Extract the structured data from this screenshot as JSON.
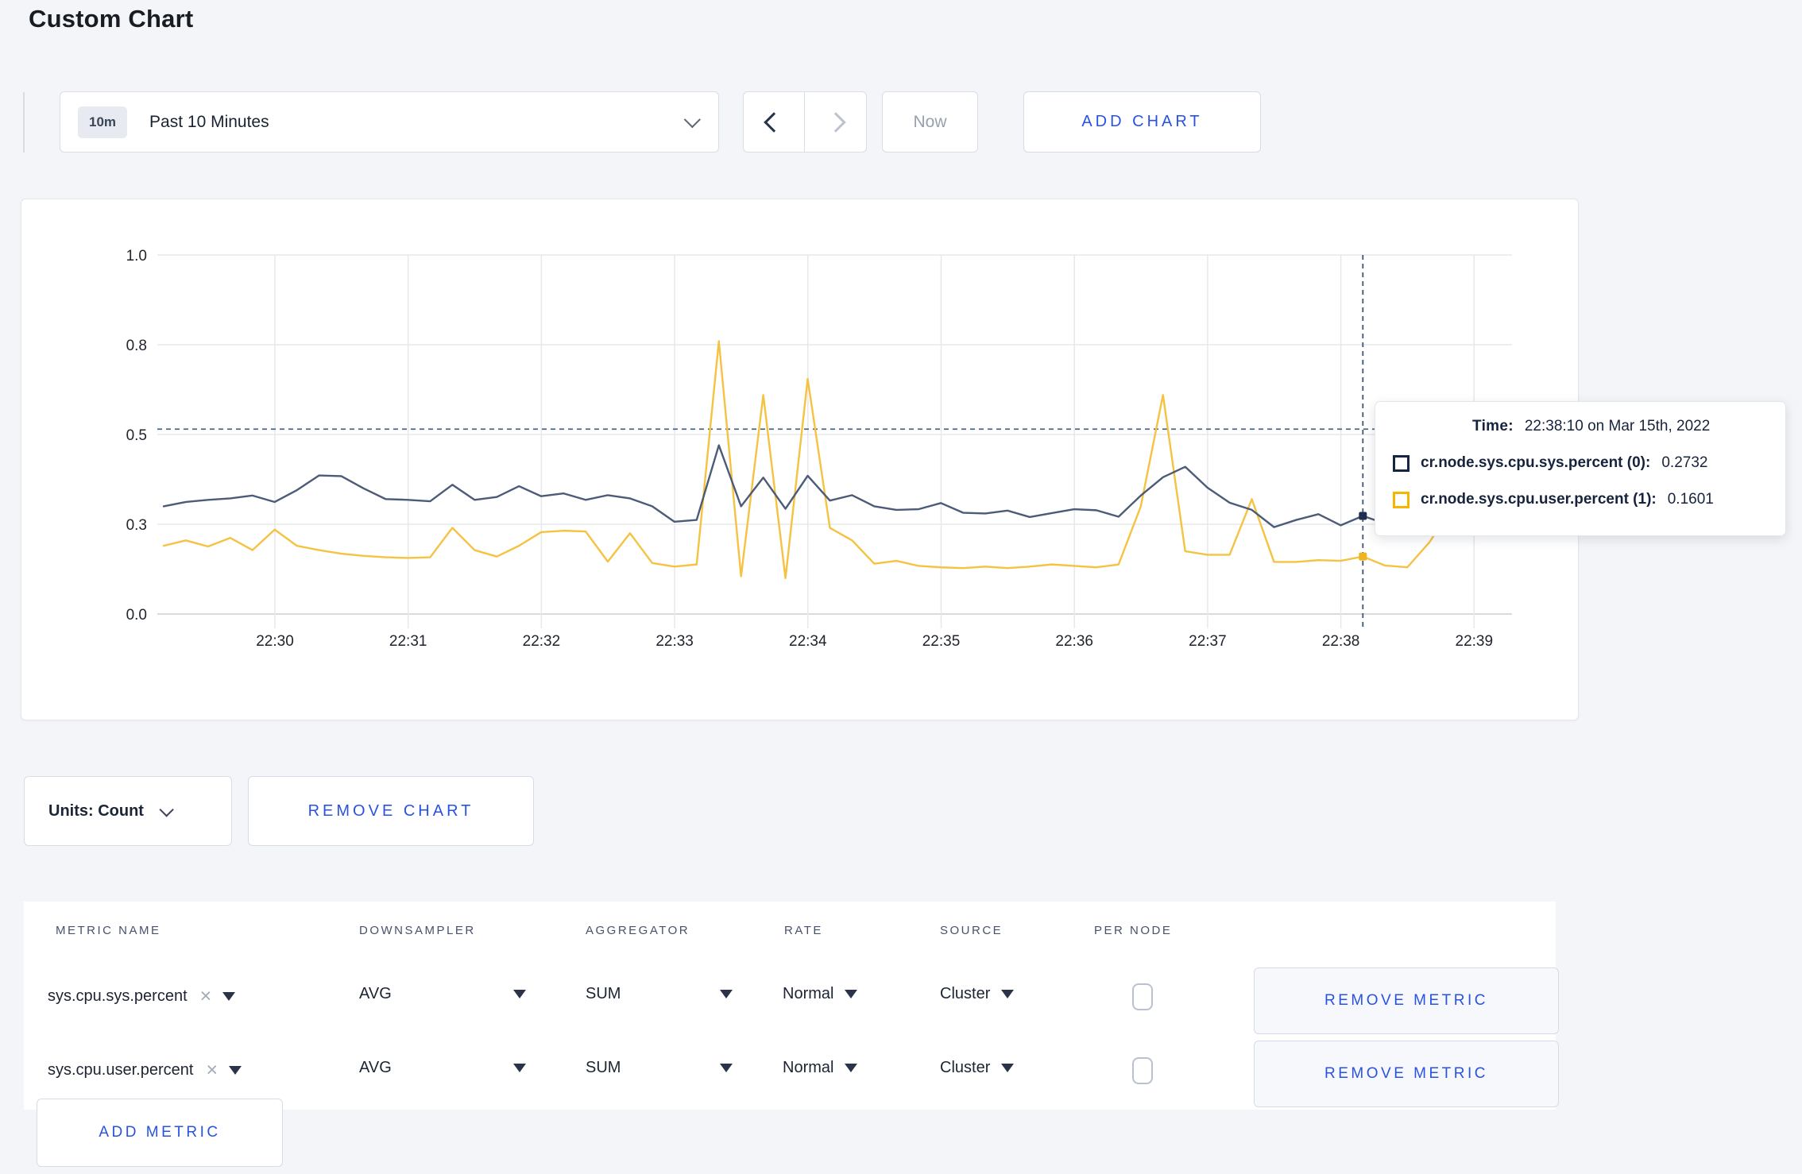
{
  "page_title": "Custom Chart",
  "toolbar": {
    "time_range_badge": "10m",
    "time_range_label": "Past 10 Minutes",
    "now_label": "Now",
    "add_chart_label": "ADD CHART"
  },
  "chart_data": {
    "type": "line",
    "title": "",
    "xlabel": "",
    "ylabel": "",
    "ylim": [
      0,
      1
    ],
    "grid": true,
    "x_tick_labels": [
      "22:30",
      "22:31",
      "22:32",
      "22:33",
      "22:34",
      "22:35",
      "22:36",
      "22:37",
      "22:38",
      "22:39"
    ],
    "y_tick_labels": [
      "0.0",
      "0.3",
      "0.5",
      "0.8",
      "1.0"
    ],
    "y_tick_values": [
      0,
      0.25,
      0.5,
      0.75,
      1.0
    ],
    "x_start_time": "22:29:10",
    "x_step_seconds": 10,
    "hover_line_value": 0.515,
    "crosshair_index": 54,
    "crosshair_time": "22:38:10",
    "series": [
      {
        "name": "cr.node.sys.cpu.sys.percent (0)",
        "color": "#4c5b77",
        "values": [
          0.3,
          0.312,
          0.318,
          0.322,
          0.33,
          0.312,
          0.345,
          0.386,
          0.384,
          0.35,
          0.32,
          0.318,
          0.314,
          0.36,
          0.318,
          0.326,
          0.356,
          0.328,
          0.336,
          0.318,
          0.331,
          0.322,
          0.3,
          0.257,
          0.262,
          0.47,
          0.3,
          0.38,
          0.293,
          0.385,
          0.316,
          0.331,
          0.3,
          0.29,
          0.292,
          0.309,
          0.282,
          0.28,
          0.288,
          0.27,
          0.281,
          0.292,
          0.289,
          0.271,
          0.33,
          0.381,
          0.41,
          0.352,
          0.31,
          0.29,
          0.242,
          0.262,
          0.278,
          0.247,
          0.2732,
          0.252,
          0.262,
          0.268,
          0.256,
          0.268
        ]
      },
      {
        "name": "cr.node.sys.cpu.user.percent (1)",
        "color": "#f5c242",
        "values": [
          0.19,
          0.205,
          0.188,
          0.212,
          0.178,
          0.235,
          0.19,
          0.178,
          0.168,
          0.162,
          0.158,
          0.156,
          0.158,
          0.24,
          0.178,
          0.16,
          0.19,
          0.228,
          0.232,
          0.23,
          0.146,
          0.225,
          0.142,
          0.132,
          0.138,
          0.76,
          0.105,
          0.61,
          0.1,
          0.655,
          0.24,
          0.205,
          0.14,
          0.148,
          0.134,
          0.13,
          0.128,
          0.132,
          0.128,
          0.132,
          0.138,
          0.134,
          0.13,
          0.138,
          0.3,
          0.61,
          0.175,
          0.165,
          0.165,
          0.32,
          0.145,
          0.145,
          0.15,
          0.148,
          0.1601,
          0.135,
          0.13,
          0.2,
          0.295,
          0.23
        ]
      }
    ],
    "legend_position": "tooltip-only"
  },
  "tooltip": {
    "time_label": "Time:",
    "time_value": "22:38:10 on Mar 15th, 2022",
    "series": [
      {
        "name": "cr.node.sys.cpu.sys.percent (0):",
        "value": "0.2732",
        "color": "#152642"
      },
      {
        "name": "cr.node.sys.cpu.user.percent (1):",
        "value": "0.1601",
        "color": "#f5b500"
      }
    ]
  },
  "units_bar": {
    "units_label": "Units: Count",
    "remove_chart_label": "REMOVE CHART"
  },
  "metrics_table": {
    "headers": [
      "METRIC NAME",
      "DOWNSAMPLER",
      "AGGREGATOR",
      "RATE",
      "SOURCE",
      "PER NODE"
    ],
    "rows": [
      {
        "metric": "sys.cpu.sys.percent",
        "downsampler": "AVG",
        "aggregator": "SUM",
        "rate": "Normal",
        "source": "Cluster",
        "per_node_checked": false,
        "remove_label": "REMOVE METRIC"
      },
      {
        "metric": "sys.cpu.user.percent",
        "downsampler": "AVG",
        "aggregator": "SUM",
        "rate": "Normal",
        "source": "Cluster",
        "per_node_checked": false,
        "remove_label": "REMOVE METRIC"
      }
    ],
    "add_metric_label": "ADD METRIC"
  },
  "colors": {
    "accent_blue": "#2952e3",
    "series_sys": "#4c5b77",
    "series_user": "#f5c242",
    "crosshair": "#4a6785",
    "grid": "#e7e8ea"
  }
}
